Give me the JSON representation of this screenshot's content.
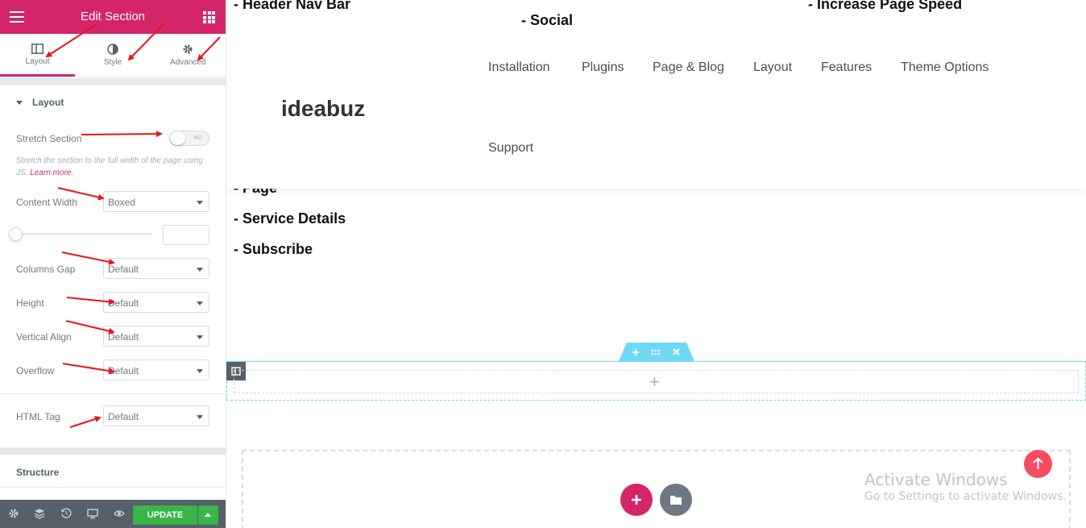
{
  "panel": {
    "title": "Edit Section",
    "tabs": [
      {
        "label": "Layout",
        "icon": "layout-icon"
      },
      {
        "label": "Style",
        "icon": "contrast-icon"
      },
      {
        "label": "Advanced",
        "icon": "gear-icon"
      }
    ],
    "layout_section_title": "Layout",
    "stretch_label": "Stretch Section",
    "stretch_toggle": "NO",
    "stretch_desc": "Stretch the section to the full width of the page using JS.",
    "learn_more": "Learn more.",
    "content_width_label": "Content Width",
    "content_width_value": "Boxed",
    "columns_gap_label": "Columns Gap",
    "columns_gap_value": "Default",
    "height_label": "Height",
    "height_value": "Default",
    "vertical_align_label": "Vertical Align",
    "vertical_align_value": "Default",
    "overflow_label": "Overflow",
    "overflow_value": "Default",
    "html_tag_label": "HTML Tag",
    "html_tag_value": "Default",
    "structure_title": "Structure",
    "update_label": "UPDATE"
  },
  "preview": {
    "partial_top_left": "- Header Nav Bar",
    "partial_top_right": "- Increase Page Speed",
    "social": "- Social",
    "logo": "ideabuz",
    "nav": [
      "Installation",
      "Plugins",
      "Page & Blog",
      "Layout",
      "Features",
      "Theme Options",
      "Support"
    ],
    "partial_page": "- Page",
    "service_details": "- Service Details",
    "subscribe": "- Subscribe",
    "activate_title": "Activate Windows",
    "activate_sub": "Go to Settings to activate Windows."
  },
  "colors": {
    "brand": "#d5256a",
    "update": "#39b54a",
    "footer": "#556068",
    "section_outline": "#71d7f7",
    "scroll_top": "#f44d63"
  }
}
